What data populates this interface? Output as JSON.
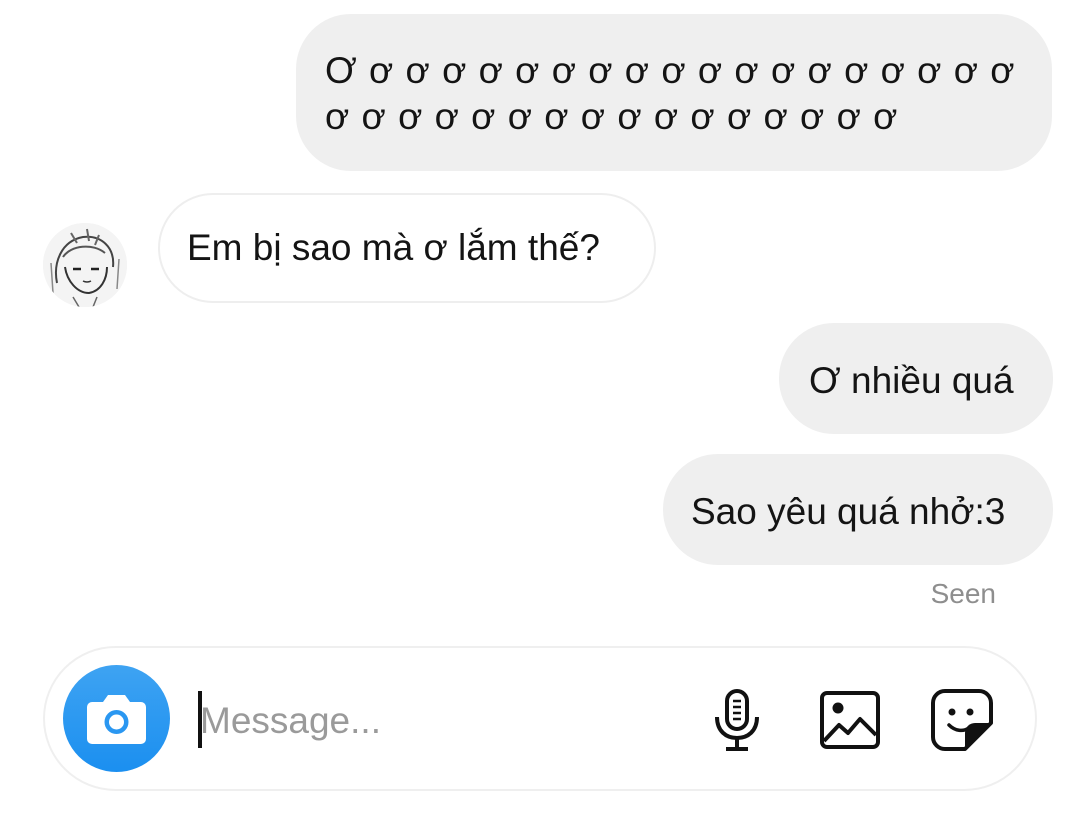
{
  "conversation": {
    "messages": [
      {
        "side": "sent",
        "text": "Ơ ơ ơ ơ ơ ơ ơ ơ ơ ơ ơ ơ ơ ơ ơ ơ ơ ơ ơ ơ ơ ơ ơ ơ ơ ơ ơ ơ ơ ơ ơ ơ ơ ơ ơ"
      },
      {
        "side": "received",
        "text": "Em bị sao mà ơ lắm thế?"
      },
      {
        "side": "sent",
        "text": "Ơ nhiều quá"
      },
      {
        "side": "sent",
        "text": "Sao yêu quá nhở:3"
      }
    ],
    "seen_label": "Seen"
  },
  "composer": {
    "placeholder": "Message...",
    "value": "",
    "icons": {
      "camera": "camera-icon",
      "mic": "microphone-icon",
      "gallery": "image-icon",
      "sticker": "sticker-icon"
    },
    "accent_color": "#2196f3"
  },
  "colors": {
    "sent_bubble": "#efefef",
    "received_border": "#eeeeee",
    "seen_text": "#8e8e8e"
  }
}
